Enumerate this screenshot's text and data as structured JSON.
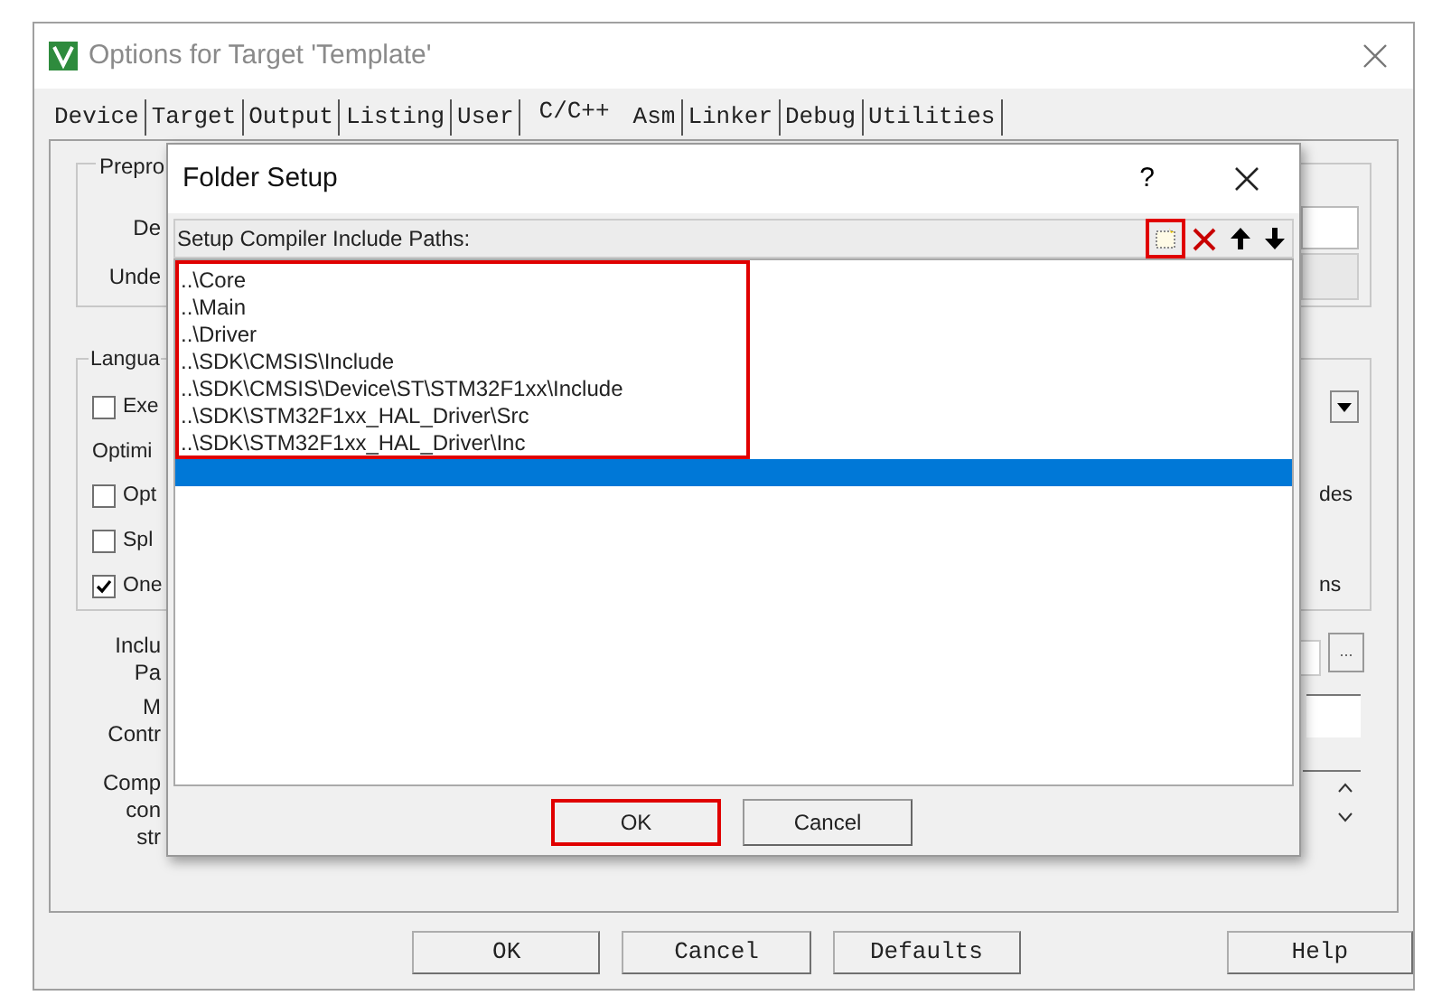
{
  "window": {
    "title": "Options for Target 'Template'"
  },
  "tabs": [
    {
      "label": "Device",
      "selected": false
    },
    {
      "label": "Target",
      "selected": false
    },
    {
      "label": "Output",
      "selected": false
    },
    {
      "label": "Listing",
      "selected": false
    },
    {
      "label": "User",
      "selected": false
    },
    {
      "label": "C/C++",
      "selected": true
    },
    {
      "label": "Asm",
      "selected": false
    },
    {
      "label": "Linker",
      "selected": false
    },
    {
      "label": "Debug",
      "selected": false
    },
    {
      "label": "Utilities",
      "selected": false
    }
  ],
  "preprocessor_group": {
    "title": "Prepro",
    "labels": [
      "De",
      "Unde"
    ]
  },
  "language_group": {
    "title": "Langua",
    "rows": [
      {
        "kind": "checkbox",
        "label": "Exe",
        "checked": false
      },
      {
        "kind": "label",
        "label": "Optimi"
      },
      {
        "kind": "checkbox",
        "label": "Opt",
        "checked": false,
        "right_text": "des"
      },
      {
        "kind": "checkbox",
        "label": "Spl",
        "checked": false
      },
      {
        "kind": "checkbox",
        "label": "One",
        "checked": true,
        "right_text": "ns"
      }
    ]
  },
  "include_labels": [
    "Inclu",
    "Pa"
  ],
  "misc_labels": [
    "M",
    "Contr"
  ],
  "compiler_labels": [
    "Comp",
    "con",
    "str"
  ],
  "browse_button": "...",
  "buttons": [
    "OK",
    "Cancel",
    "Defaults",
    "Help"
  ],
  "dialog": {
    "title": "Folder Setup",
    "help": "?",
    "header": "Setup Compiler Include Paths:",
    "new_tool_highlighted": true,
    "paths": {
      "highlighted": true,
      "blank_row_selected": true,
      "items": [
        "..\\Core",
        "..\\Main",
        "..\\Driver",
        "..\\SDK\\CMSIS\\Include",
        "..\\SDK\\CMSIS\\Device\\ST\\STM32F1xx\\Include",
        "..\\SDK\\STM32F1xx_HAL_Driver\\Src",
        "..\\SDK\\STM32F1xx_HAL_Driver\\Inc"
      ]
    },
    "buttons": [
      {
        "label": "OK",
        "highlighted": true
      },
      {
        "label": "Cancel",
        "highlighted": false
      }
    ]
  }
}
